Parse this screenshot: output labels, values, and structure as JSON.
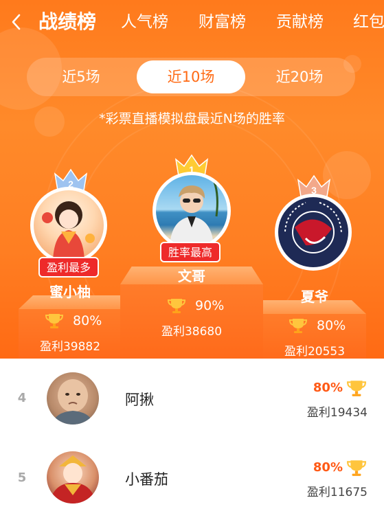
{
  "nav": {
    "back_icon": "chevron-left-icon",
    "tabs": [
      {
        "label": "战绩榜",
        "active": true
      },
      {
        "label": "人气榜",
        "active": false
      },
      {
        "label": "财富榜",
        "active": false
      },
      {
        "label": "贡献榜",
        "active": false
      },
      {
        "label": "红包",
        "active": false
      }
    ]
  },
  "segments": [
    {
      "label": "近5场",
      "active": false
    },
    {
      "label": "近10场",
      "active": true
    },
    {
      "label": "近20场",
      "active": false
    }
  ],
  "subtitle": "*彩票直播模拟盘最近N场的胜率",
  "podium": {
    "first": {
      "rank": "1",
      "badge": "胜率最高",
      "name": "文哥",
      "rate": "90%",
      "profit": "盈利38680"
    },
    "second": {
      "rank": "2",
      "badge": "盈利最多",
      "name": "蜜小柚",
      "rate": "80%",
      "profit": "盈利39882"
    },
    "third": {
      "rank": "3",
      "name": "夏爷",
      "rate": "80%",
      "profit": "盈利20553"
    }
  },
  "list": [
    {
      "rank": "4",
      "name": "阿揪",
      "rate": "80%",
      "profit": "盈利19434"
    },
    {
      "rank": "5",
      "name": "小番茄",
      "rate": "80%",
      "profit": "盈利11675"
    }
  ],
  "colors": {
    "accent": "#ff7a1c",
    "badge_red": "#ee2a2a",
    "rate_orange": "#ff5a16",
    "gold": "#ffc53d"
  }
}
